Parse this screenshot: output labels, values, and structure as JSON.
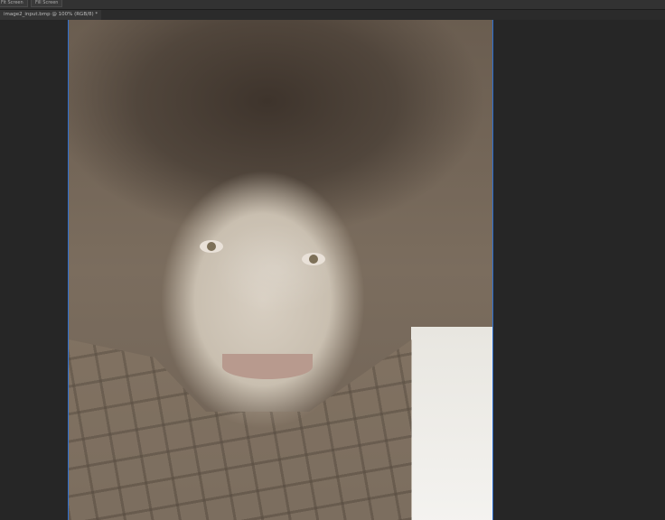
{
  "toolbar": {
    "fit_screen": "Fit Screen",
    "fill_screen": "Fill Screen"
  },
  "document_tab": {
    "title": "image2_input.bmp @ 100% (RGB/8) *"
  },
  "accent_color": "#2d6fd0"
}
